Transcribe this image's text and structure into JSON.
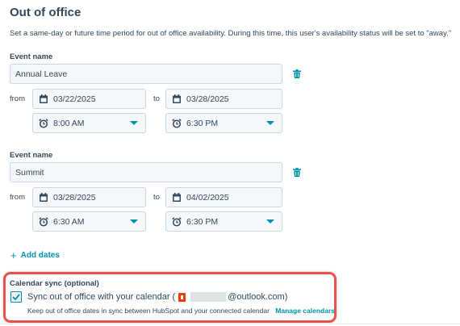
{
  "section": {
    "title": "Out of office",
    "description": "Set a same-day or future time period for out of office availability. During this time, this user's availability status will be set to \"away.\""
  },
  "events": [
    {
      "name_label": "Event name",
      "name_value": "Annual Leave",
      "from_label": "from",
      "to_label": "to",
      "start_date": "03/22/2025",
      "end_date": "03/28/2025",
      "start_time": "8:00 AM",
      "end_time": "6:30 PM"
    },
    {
      "name_label": "Event name",
      "name_value": "Summit",
      "from_label": "from",
      "to_label": "to",
      "start_date": "03/28/2025",
      "end_date": "04/02/2025",
      "start_time": "6:30 AM",
      "end_time": "6:30 PM"
    }
  ],
  "add_dates_label": "Add dates",
  "calendar_sync": {
    "title": "Calendar sync (optional)",
    "checked": true,
    "text_prefix": "Sync out of office with your calendar (",
    "email_suffix": "@outlook.com)",
    "subtext": "Keep out of office dates in sync between HubSpot and your connected calendar",
    "manage_link": "Manage calendars"
  },
  "colors": {
    "accent": "#0091ae",
    "text": "#33475b",
    "highlight_border": "#e8524a",
    "field_bg": "#f5f8fa",
    "field_border": "#cbd6e2"
  },
  "icons": [
    "calendar-icon",
    "alarm-clock-icon",
    "trash-icon",
    "chevron-down-icon",
    "plus-icon",
    "check-icon",
    "office-icon"
  ]
}
